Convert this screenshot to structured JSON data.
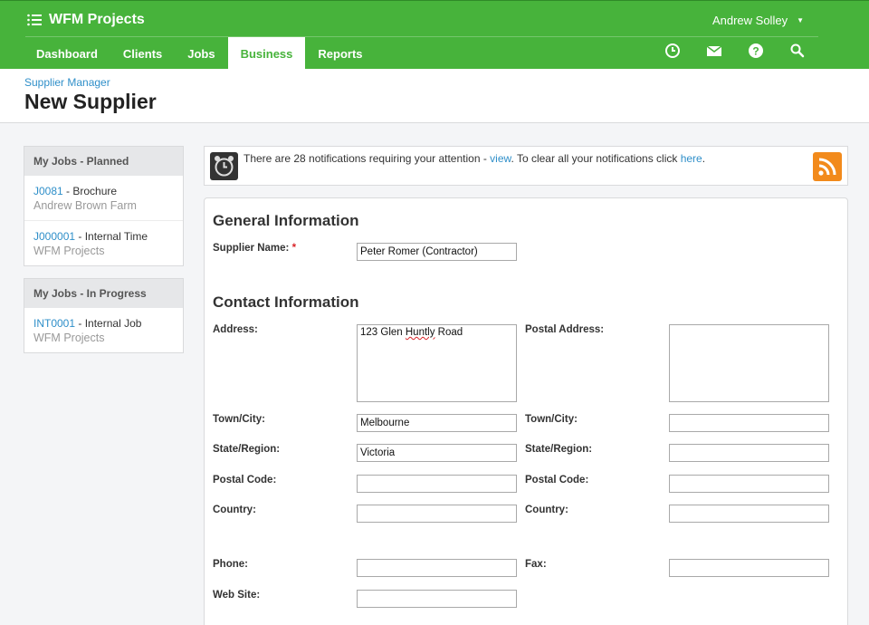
{
  "app": {
    "title": "WFM Projects",
    "user": "Andrew Solley"
  },
  "nav": {
    "tabs": [
      {
        "label": "Dashboard"
      },
      {
        "label": "Clients"
      },
      {
        "label": "Jobs"
      },
      {
        "label": "Business"
      },
      {
        "label": "Reports"
      }
    ],
    "active": "Business",
    "icons": [
      "clock-icon",
      "mail-icon",
      "help-icon",
      "search-icon"
    ]
  },
  "header": {
    "breadcrumb": "Supplier Manager",
    "title": "New Supplier"
  },
  "sidebar": {
    "planned": {
      "title": "My Jobs - Planned",
      "items": [
        {
          "code": "J0081",
          "name": "Brochure",
          "client": "Andrew Brown Farm"
        },
        {
          "code": "J000001",
          "name": "Internal Time",
          "client": "WFM Projects"
        }
      ]
    },
    "in_progress": {
      "title": "My Jobs - In Progress",
      "items": [
        {
          "code": "INT0001",
          "name": "Internal Job",
          "client": "WFM Projects"
        }
      ]
    }
  },
  "notification": {
    "text_before": "There are 28 notifications requiring your attention - ",
    "view_link": "view",
    "text_middle": ". To clear all your notifications click ",
    "here_link": "here",
    "text_after": "."
  },
  "form": {
    "general_title": "General Information",
    "supplier_name_label": "Supplier Name:",
    "required_mark": "*",
    "supplier_name": "Peter Romer (Contractor)",
    "contact_title": "Contact Information",
    "address_label": "Address:",
    "address_line_prefix": "123 Glen ",
    "address_misspelled": "Huntly",
    "address_line_suffix": " Road",
    "postal_address_label": "Postal Address:",
    "postal_address": "",
    "town_label": "Town/City:",
    "town": "Melbourne",
    "postal_town_label": "Town/City:",
    "postal_town": "",
    "state_label": "State/Region:",
    "state": "Victoria",
    "postal_state_label": "State/Region:",
    "postal_state": "",
    "postcode_label": "Postal Code:",
    "postcode": "",
    "postal_postcode_label": "Postal Code:",
    "postal_postcode": "",
    "country_label": "Country:",
    "country": "",
    "postal_country_label": "Country:",
    "postal_country": "",
    "phone_label": "Phone:",
    "phone": "",
    "fax_label": "Fax:",
    "fax": "",
    "website_label": "Web Site:",
    "website": ""
  },
  "colors": {
    "brand_green": "#47b33b",
    "link_blue": "#2f8fc9",
    "required_red": "#d9252a",
    "rss_orange": "#f28a1b"
  }
}
